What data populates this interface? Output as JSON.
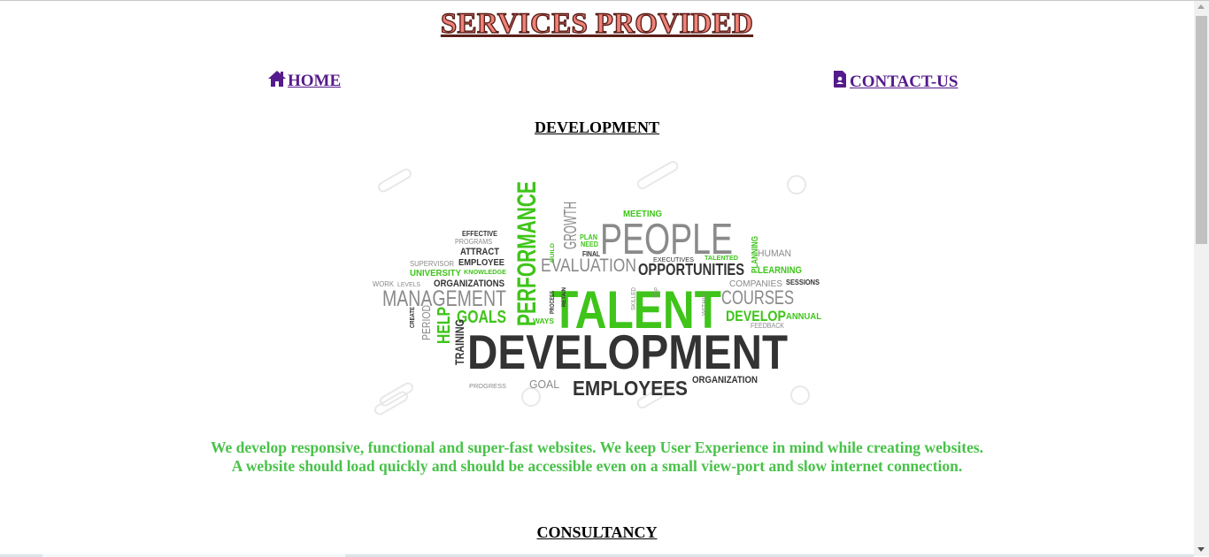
{
  "page": {
    "title": "SERVICES PROVIDED"
  },
  "nav": {
    "home_label": "HOME",
    "home_icon": "home-icon",
    "contact_label": "CONTACT-US",
    "contact_icon": "contact-card-icon",
    "link_color": "#551a8b"
  },
  "sections": [
    {
      "heading": "DEVELOPMENT",
      "image_words": {
        "TALENT": "TALENT",
        "DEVELOPMENT": "DEVELOPMENT",
        "PEOPLE": "PEOPLE",
        "PERFORMANCE": "PERFORMANCE",
        "MANAGEMENT": "MANAGEMENT",
        "EVALUATION": "EVALUATION",
        "OPPORTUNITIES": "OPPORTUNITIES",
        "COURSES": "COURSES",
        "EMPLOYEES": "EMPLOYEES",
        "GOALS": "GOALS",
        "DEVELOP": "DEVELOP",
        "GROWTH": "GROWTH",
        "HELP": "HELP",
        "TRAINING": "TRAINING",
        "PERIOD": "PERIOD",
        "GOAL": "GOAL",
        "ORGANIZATION": "ORGANIZATION",
        "ORGANIZATIONS": "ORGANIZATIONS",
        "MEETING": "MEETING",
        "HUMAN": "HUMAN",
        "LEARNING": "LEARNING",
        "PLANNING": "PLANNING",
        "COMPANIES": "COMPANIES",
        "SESSIONS": "SESSIONS",
        "ANNUAL": "ANNUAL",
        "FEEDBACK": "FEEDBACK",
        "EFFECTIVE": "EFFECTIVE",
        "PROGRAMS": "PROGRAMS",
        "ATTRACT": "ATTRACT",
        "SUPERVISOR": "SUPERVISOR",
        "EMPLOYEE": "EMPLOYEE",
        "UNIVERSITY": "UNIVERSITY",
        "KNOWLEDGE": "KNOWLEDGE",
        "WORK": "WORK",
        "LEVELS": "LEVELS",
        "EXECUTIVES": "EXECUTIVES",
        "TALENTED": "TALENTED",
        "PLAN": "PLAN",
        "NEED": "NEED",
        "FINAL": "FINAL",
        "BUILD": "BUILD",
        "RETAIN": "RETAIN",
        "PROCESS": "PROCESS",
        "WAYS": "WAYS",
        "SKILLED": "SKILLED",
        "TOP": "TOP",
        "WITHIN": "WITHIN",
        "CREATE": "CREATE",
        "PROGRESS": "PROGRESS"
      },
      "description_line1": "We develop responsive, functional and super-fast websites. We keep User Experience in mind while creating websites.",
      "description_line2": "A website should load quickly and should be accessible even on a small view-port and slow internet connection."
    },
    {
      "heading": "CONSULTANCY"
    }
  ],
  "colors": {
    "title_fill": "#f08278",
    "title_outline": "#5b1f1a",
    "description_text": "#49c24a",
    "word_green": "#3fc41a",
    "word_dark": "#333333",
    "word_gray": "#8a8a8a"
  }
}
